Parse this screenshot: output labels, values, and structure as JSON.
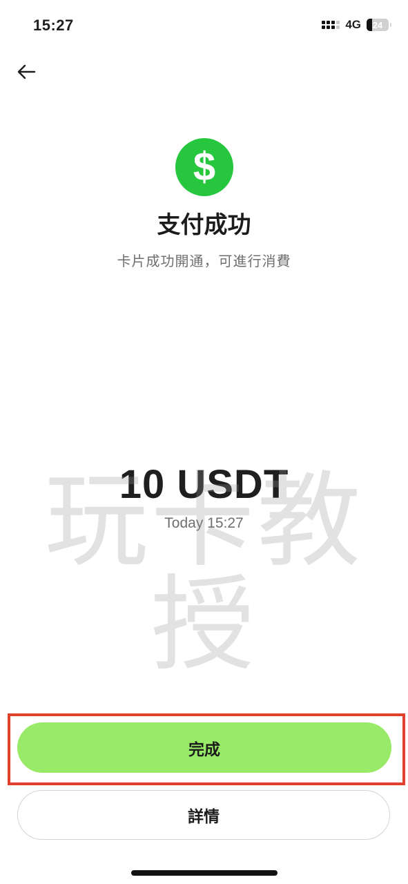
{
  "status_bar": {
    "time": "15:27",
    "network": "4G",
    "battery": 24,
    "battery_label": "24"
  },
  "icons": {
    "back": "back-arrow-icon",
    "success": "dollar-circle-icon",
    "success_glyph": "$"
  },
  "result": {
    "title": "支付成功",
    "subtitle": "卡片成功開通，可進行消費",
    "amount": "10 USDT",
    "datetime": "Today 15:27"
  },
  "watermark": "玩卡教授",
  "actions": {
    "done_label": "完成",
    "details_label": "詳情"
  },
  "colors": {
    "success_green": "#27c63f",
    "primary_button": "#98ea68",
    "highlight_border": "#e1412b"
  }
}
